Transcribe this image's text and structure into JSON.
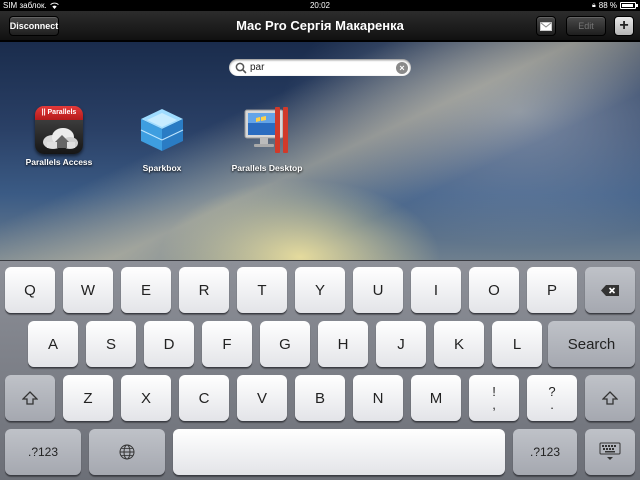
{
  "status_bar": {
    "carrier": "SIM заблок.",
    "time": "20:02",
    "battery_percent": "88 %",
    "battery_level": 0.88
  },
  "nav": {
    "title": "Mac Pro Сергія Макаренка",
    "disconnect_label": "Disconnect",
    "edit_label": "Edit",
    "plus_label": "+",
    "mail_icon": "envelope-icon"
  },
  "search": {
    "value": "par"
  },
  "apps": [
    {
      "label": "Parallels Access",
      "icon": "parallels-access-icon",
      "banner": "|| Parallels"
    },
    {
      "label": "Sparkbox",
      "icon": "sparkbox-icon"
    },
    {
      "label": "Parallels Desktop",
      "icon": "parallels-desktop-icon"
    }
  ],
  "keyboard": {
    "row1": [
      "Q",
      "W",
      "E",
      "R",
      "T",
      "Y",
      "U",
      "I",
      "O",
      "P"
    ],
    "row2": [
      "A",
      "S",
      "D",
      "F",
      "G",
      "H",
      "J",
      "K",
      "L"
    ],
    "row3": [
      "Z",
      "X",
      "C",
      "V",
      "B",
      "N",
      "M"
    ],
    "search_label": "Search",
    "numbers_label": ".?123",
    "exclaim_top": "!",
    "exclaim_bottom": ",",
    "question_top": "?",
    "question_bottom": "."
  },
  "colors": {
    "parallels_red": "#d42a2a",
    "nav_background": "#1c1c1c"
  }
}
